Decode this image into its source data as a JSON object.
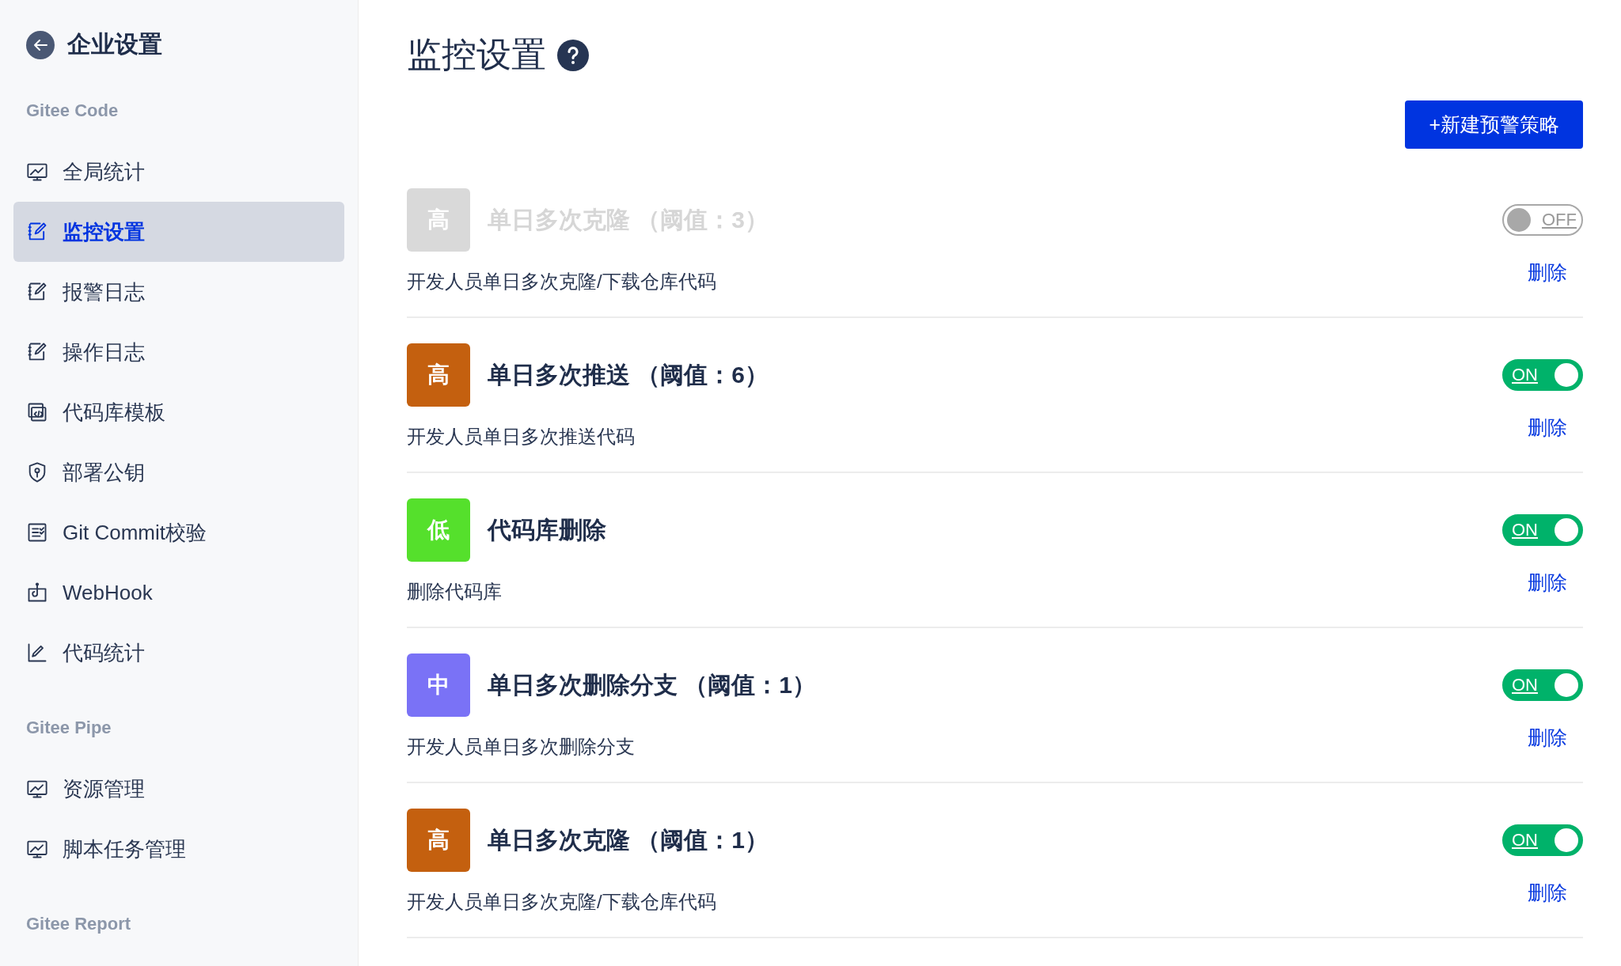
{
  "sidebar": {
    "back_title": "企业设置",
    "sections": [
      {
        "title": "Gitee Code",
        "items": [
          {
            "label": "全局统计",
            "selected": false
          },
          {
            "label": "监控设置",
            "selected": true
          },
          {
            "label": "报警日志",
            "selected": false
          },
          {
            "label": "操作日志",
            "selected": false
          },
          {
            "label": "代码库模板",
            "selected": false
          },
          {
            "label": "部署公钥",
            "selected": false
          },
          {
            "label": "Git Commit校验",
            "selected": false
          },
          {
            "label": "WebHook",
            "selected": false
          },
          {
            "label": "代码统计",
            "selected": false
          }
        ]
      },
      {
        "title": "Gitee Pipe",
        "items": [
          {
            "label": "资源管理",
            "selected": false
          },
          {
            "label": "脚本任务管理",
            "selected": false
          }
        ]
      },
      {
        "title": "Gitee Report"
      }
    ]
  },
  "page": {
    "title": "监控设置",
    "new_button": "+新建预警策略"
  },
  "rules": [
    {
      "level": "高",
      "title": "单日多次克隆 （阈值：3）",
      "description": "开发人员单日多次克隆/下载仓库代码",
      "on": false,
      "toggle_label": "OFF",
      "delete": "删除"
    },
    {
      "level": "高",
      "color": "#c4600f",
      "title": "单日多次推送 （阈值：6）",
      "description": "开发人员单日多次推送代码",
      "on": true,
      "toggle_label": "ON",
      "delete": "删除"
    },
    {
      "level": "低",
      "color": "#55e02c",
      "title": "代码库删除",
      "description": "删除代码库",
      "on": true,
      "toggle_label": "ON",
      "delete": "删除"
    },
    {
      "level": "中",
      "color": "#7a72f6",
      "title": "单日多次删除分支 （阈值：1）",
      "description": "开发人员单日多次删除分支",
      "on": true,
      "toggle_label": "ON",
      "delete": "删除"
    },
    {
      "level": "高",
      "color": "#c4600f",
      "title": "单日多次克隆 （阈值：1）",
      "description": "开发人员单日多次克隆/下载仓库代码",
      "on": true,
      "toggle_label": "ON",
      "delete": "删除"
    }
  ]
}
